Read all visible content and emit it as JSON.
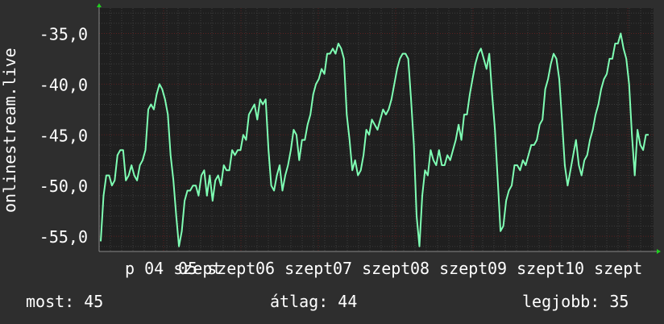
{
  "chart_data": {
    "type": "line",
    "ylabel": "onlinestream.live",
    "ylim": [
      -56.5,
      -32.5
    ],
    "yticks": [
      -35,
      -40,
      -45,
      -50,
      -55
    ],
    "ytick_labels": [
      "-35,0",
      "-40,0",
      "-45,0",
      "-50,0",
      "-55,0"
    ],
    "xticks": [
      "p 04 szept",
      "05 szept",
      "06 szept",
      "07 szept",
      "08 szept",
      "09 szept",
      "10 szept"
    ],
    "grid": true,
    "colors": {
      "background": "#2e2e2e",
      "plot_background": "#1f1f1f",
      "line": "#7fffb4",
      "grid_major": "#5a2020",
      "grid_minor": "#3c3c3c",
      "arrow": "#20d020"
    },
    "series": [
      {
        "values": [
          -55.5,
          -51.0,
          -49.0,
          -49.0,
          -50.0,
          -49.5,
          -47.0,
          -46.5,
          -46.5,
          -49.5,
          -49.0,
          -48.0,
          -49.0,
          -49.5,
          -48.0,
          -47.5,
          -46.5,
          -42.5,
          -42.0,
          -42.5,
          -41.0,
          -40.0,
          -40.5,
          -41.5,
          -43.0,
          -47.0,
          -49.5,
          -53.0,
          -56.0,
          -54.5,
          -51.5,
          -50.5,
          -50.5,
          -50.0,
          -50.0,
          -51.0,
          -49.0,
          -48.5,
          -51.0,
          -49.0,
          -51.5,
          -49.5,
          -49.0,
          -50.0,
          -48.0,
          -48.5,
          -48.5,
          -46.5,
          -47.0,
          -46.5,
          -46.5,
          -45.0,
          -45.5,
          -43.0,
          -42.5,
          -42.0,
          -43.5,
          -41.5,
          -42.0,
          -41.5,
          -46.5,
          -50.0,
          -50.5,
          -49.0,
          -48.0,
          -50.5,
          -49.0,
          -48.0,
          -46.5,
          -44.5,
          -45.0,
          -47.5,
          -45.5,
          -45.5,
          -44.0,
          -43.0,
          -41.0,
          -40.0,
          -39.5,
          -38.5,
          -39.0,
          -37.0,
          -37.0,
          -36.5,
          -37.0,
          -36.0,
          -36.5,
          -37.5,
          -43.0,
          -45.5,
          -48.5,
          -47.5,
          -49.0,
          -48.5,
          -47.0,
          -44.5,
          -45.0,
          -43.5,
          -44.0,
          -44.5,
          -43.5,
          -42.5,
          -43.0,
          -42.5,
          -41.5,
          -40.0,
          -38.5,
          -37.5,
          -37.0,
          -37.0,
          -37.5,
          -41.5,
          -46.0,
          -53.0,
          -56.0,
          -51.0,
          -48.5,
          -49.0,
          -46.5,
          -47.5,
          -48.0,
          -46.5,
          -48.0,
          -48.0,
          -47.0,
          -47.5,
          -46.5,
          -45.5,
          -44.0,
          -45.5,
          -43.0,
          -43.0,
          -41.0,
          -39.5,
          -38.0,
          -37.0,
          -36.5,
          -37.5,
          -38.5,
          -37.0,
          -41.0,
          -44.5,
          -49.5,
          -54.5,
          -54.0,
          -51.5,
          -50.5,
          -50.0,
          -48.0,
          -48.0,
          -48.5,
          -47.5,
          -48.0,
          -47.0,
          -46.0,
          -46.0,
          -45.5,
          -44.0,
          -43.5,
          -40.5,
          -39.5,
          -38.0,
          -37.0,
          -37.5,
          -39.5,
          -43.5,
          -48.0,
          -50.0,
          -48.5,
          -47.0,
          -45.5,
          -48.0,
          -49.0,
          -47.5,
          -47.0,
          -45.5,
          -44.5,
          -43.0,
          -42.0,
          -40.5,
          -39.5,
          -39.0,
          -37.5,
          -37.5,
          -36.0,
          -36.0,
          -35.0,
          -36.5,
          -37.5,
          -40.0,
          -45.0,
          -49.0,
          -44.5,
          -46.0,
          -46.5,
          -45.0,
          -45.0
        ]
      }
    ]
  },
  "stats": {
    "current": "most: 45",
    "average": "átlag: 44",
    "best": "legjobb: 35"
  }
}
